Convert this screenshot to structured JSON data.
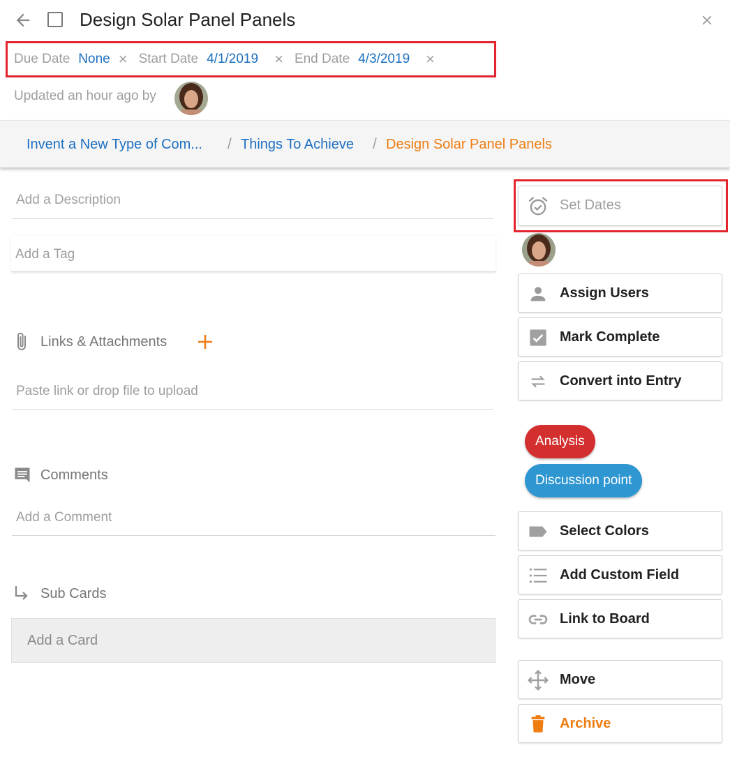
{
  "header": {
    "title": "Design Solar Panel Panels"
  },
  "dates": {
    "due_label": "Due Date",
    "due_value": "None",
    "start_label": "Start Date",
    "start_value": "4/1/2019",
    "end_label": "End Date",
    "end_value": "4/3/2019",
    "clear_glyph": "×"
  },
  "updated_text": "Updated an hour ago by",
  "breadcrumb": {
    "items": [
      {
        "label": "Invent a New Type of Com..."
      },
      {
        "label": "Things To Achieve"
      },
      {
        "label": "Design Solar Panel Panels"
      }
    ],
    "separator": "/"
  },
  "left": {
    "description_placeholder": "Add a Description",
    "tag_placeholder": "Add a Tag",
    "links_label": "Links & Attachments",
    "links_placeholder": "Paste link or drop file to upload",
    "comments_label": "Comments",
    "comment_placeholder": "Add a Comment",
    "subcards_label": "Sub Cards",
    "add_card_label": "Add a Card"
  },
  "right": {
    "set_dates": "Set Dates",
    "assign_users": "Assign Users",
    "mark_complete": "Mark Complete",
    "convert_entry": "Convert into Entry",
    "tags": [
      {
        "label": "Analysis",
        "color": "#d32f2f"
      },
      {
        "label": "Discussion point",
        "color": "#2e96d1"
      }
    ],
    "select_colors": "Select Colors",
    "add_custom_field": "Add Custom Field",
    "link_to_board": "Link to Board",
    "move": "Move",
    "archive": "Archive"
  },
  "colors": {
    "link": "#1c6fc0",
    "accent": "#ef7d12",
    "highlight_border": "#e32530"
  }
}
